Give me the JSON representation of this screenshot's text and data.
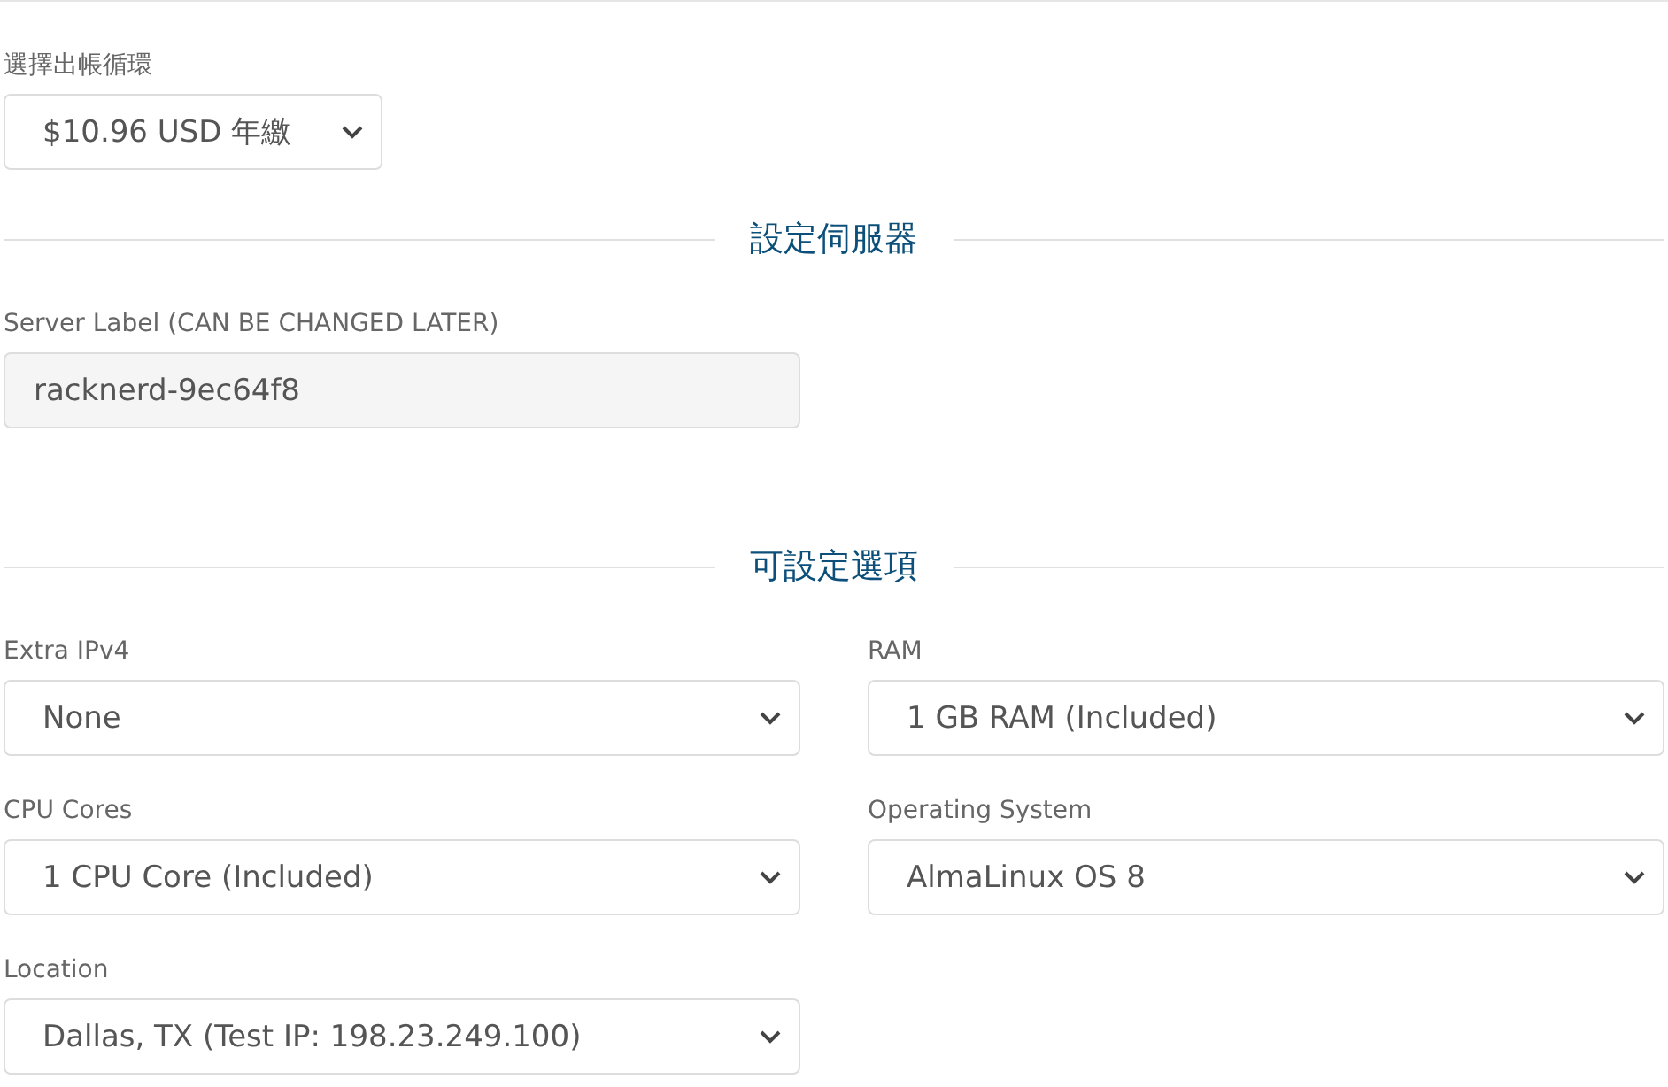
{
  "billing_cycle": {
    "label": "選擇出帳循環",
    "value": "$10.96 USD 年繳"
  },
  "server_section": {
    "heading": "設定伺服器",
    "field_label": "Server Label (CAN BE CHANGED LATER)",
    "value": "racknerd-9ec64f8"
  },
  "options_section": {
    "heading": "可設定選項",
    "options": [
      {
        "label": "Extra IPv4",
        "value": "None"
      },
      {
        "label": "RAM",
        "value": "1 GB RAM (Included)"
      },
      {
        "label": "CPU Cores",
        "value": "1 CPU Core (Included)"
      },
      {
        "label": "Operating System",
        "value": "AlmaLinux OS 8"
      },
      {
        "label": "Location",
        "value": "Dallas, TX (Test IP: 198.23.249.100)"
      }
    ]
  }
}
